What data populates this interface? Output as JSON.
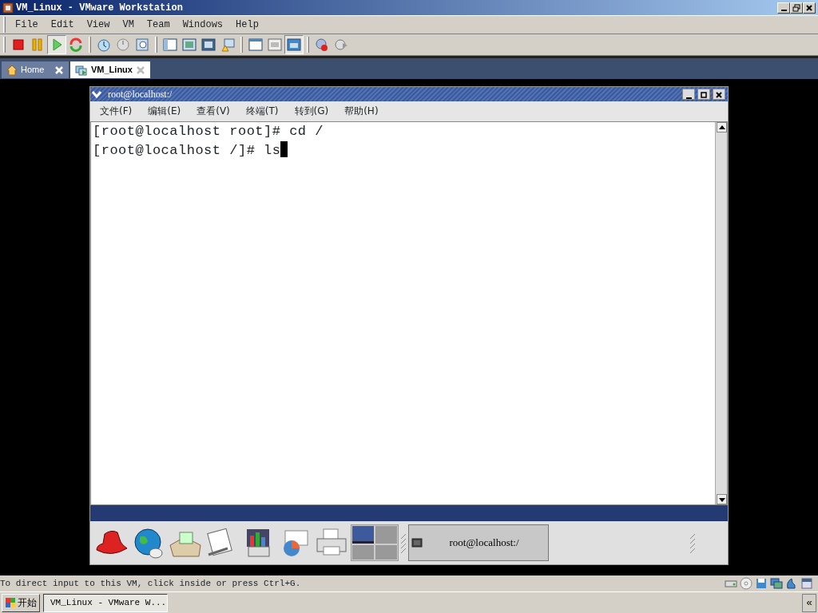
{
  "window": {
    "title": "VM_Linux - VMware Workstation"
  },
  "menu": [
    "File",
    "Edit",
    "View",
    "VM",
    "Team",
    "Windows",
    "Help"
  ],
  "toolbar": [
    [
      {
        "kind": "stop",
        "pressed": false
      },
      {
        "kind": "pause",
        "pressed": false
      },
      {
        "kind": "play",
        "pressed": true
      },
      {
        "kind": "reset",
        "pressed": false
      }
    ],
    [
      {
        "kind": "snapshot",
        "pressed": false
      },
      {
        "kind": "revert",
        "pressed": false
      },
      {
        "kind": "manager",
        "pressed": false
      }
    ],
    [
      {
        "kind": "sidebar",
        "pressed": false
      },
      {
        "kind": "fullscreen",
        "pressed": false
      },
      {
        "kind": "fit",
        "pressed": false
      },
      {
        "kind": "unity",
        "pressed": false
      }
    ],
    [
      {
        "kind": "settings",
        "pressed": false
      },
      {
        "kind": "console",
        "pressed": false
      },
      {
        "kind": "quickswitch",
        "pressed": true
      }
    ],
    [
      {
        "kind": "record",
        "pressed": false
      },
      {
        "kind": "replay",
        "pressed": false
      }
    ]
  ],
  "tabs": [
    {
      "label": "Home",
      "kind": "home",
      "selected": false
    },
    {
      "label": "VM_Linux",
      "kind": "vm",
      "selected": true
    }
  ],
  "guest": {
    "title": "root@localhost:/",
    "menu": [
      "文件(F)",
      "编辑(E)",
      "查看(V)",
      "终端(T)",
      "转到(G)",
      "帮助(H)"
    ],
    "lines": [
      "[root@localhost root]# cd /",
      "[root@localhost /]# ls"
    ],
    "panel_launchers": [
      {
        "kind": "hat"
      },
      {
        "kind": "globe"
      },
      {
        "kind": "mail"
      },
      {
        "kind": "document"
      },
      {
        "kind": "chart"
      },
      {
        "kind": "spreadsheet"
      },
      {
        "kind": "printer"
      }
    ],
    "workspaces": [
      {
        "selected": true
      },
      {
        "selected": false
      },
      {
        "selected": false
      },
      {
        "selected": false
      }
    ],
    "task": "root@localhost:/"
  },
  "status_bar": {
    "text": "To direct input to this VM, click inside or press Ctrl+G."
  },
  "taskbar": {
    "start": "开始",
    "task": "VM_Linux - VMware W...",
    "chevron": "«"
  }
}
